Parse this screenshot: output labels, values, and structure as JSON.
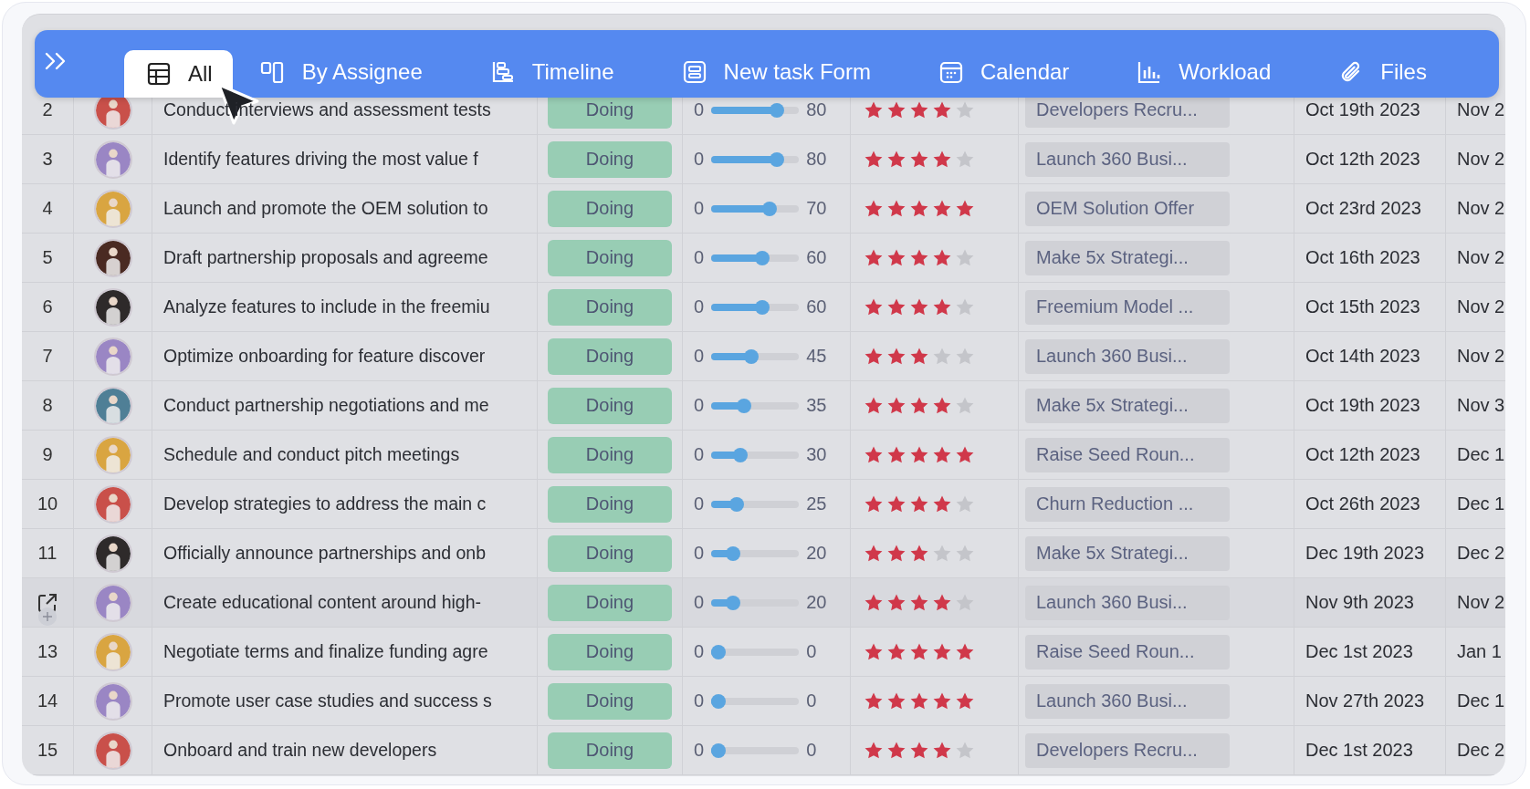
{
  "toolbar": {
    "tabs": [
      {
        "label": "All",
        "selected": true
      },
      {
        "label": "By Assignee",
        "selected": false
      },
      {
        "label": "Timeline",
        "selected": false
      },
      {
        "label": "New task Form",
        "selected": false
      },
      {
        "label": "Calendar",
        "selected": false
      },
      {
        "label": "Workload",
        "selected": false
      },
      {
        "label": "Files",
        "selected": false
      }
    ]
  },
  "table": {
    "rows": [
      {
        "number": "2",
        "hovered": false,
        "avatar": {
          "color": "#c9504a"
        },
        "title": "Conduct interviews and assessment tests",
        "status": "Doing",
        "progress": {
          "min": "0",
          "level": 0.8,
          "value": "80"
        },
        "stars": 4,
        "goal": "Developers Recru...",
        "start": "Oct 19th 2023",
        "end": "Nov 2"
      },
      {
        "number": "3",
        "hovered": false,
        "avatar": {
          "color": "#9a86c4"
        },
        "title": "Identify features driving the most value f",
        "status": "Doing",
        "progress": {
          "min": "0",
          "level": 0.8,
          "value": "80"
        },
        "stars": 4,
        "goal": "Launch 360 Busi...",
        "start": "Oct 12th 2023",
        "end": "Nov 2"
      },
      {
        "number": "4",
        "hovered": false,
        "avatar": {
          "color": "#d9a541"
        },
        "title": "Launch and promote the OEM solution to",
        "status": "Doing",
        "progress": {
          "min": "0",
          "level": 0.7,
          "value": "70"
        },
        "stars": 5,
        "goal": "OEM Solution Offer",
        "start": "Oct 23rd 2023",
        "end": "Nov 2"
      },
      {
        "number": "5",
        "hovered": false,
        "avatar": {
          "color": "#4a2a22"
        },
        "title": "Draft partnership proposals and agreeme",
        "status": "Doing",
        "progress": {
          "min": "0",
          "level": 0.6,
          "value": "60"
        },
        "stars": 4,
        "goal": "Make 5x Strategi...",
        "start": "Oct 16th 2023",
        "end": "Nov 2"
      },
      {
        "number": "6",
        "hovered": false,
        "avatar": {
          "color": "#2e2a2a"
        },
        "title": "Analyze features to include in the freemiu",
        "status": "Doing",
        "progress": {
          "min": "0",
          "level": 0.6,
          "value": "60"
        },
        "stars": 4,
        "goal": "Freemium Model ...",
        "start": "Oct 15th 2023",
        "end": "Nov 2"
      },
      {
        "number": "7",
        "hovered": false,
        "avatar": {
          "color": "#9a86c4"
        },
        "title": "Optimize onboarding for feature discover",
        "status": "Doing",
        "progress": {
          "min": "0",
          "level": 0.45,
          "value": "45"
        },
        "stars": 3,
        "goal": "Launch 360 Busi...",
        "start": "Oct 14th 2023",
        "end": "Nov 2"
      },
      {
        "number": "8",
        "hovered": false,
        "avatar": {
          "color": "#4f7f96"
        },
        "title": "Conduct partnership negotiations and me",
        "status": "Doing",
        "progress": {
          "min": "0",
          "level": 0.35,
          "value": "35"
        },
        "stars": 4,
        "goal": "Make 5x Strategi...",
        "start": "Oct 19th 2023",
        "end": "Nov 3"
      },
      {
        "number": "9",
        "hovered": false,
        "avatar": {
          "color": "#d9a541"
        },
        "title": "Schedule and conduct pitch meetings",
        "status": "Doing",
        "progress": {
          "min": "0",
          "level": 0.3,
          "value": "30"
        },
        "stars": 5,
        "goal": "Raise Seed Roun...",
        "start": "Oct 12th 2023",
        "end": "Dec 1"
      },
      {
        "number": "10",
        "hovered": false,
        "avatar": {
          "color": "#c9504a"
        },
        "title": "Develop strategies to address the main c",
        "status": "Doing",
        "progress": {
          "min": "0",
          "level": 0.25,
          "value": "25"
        },
        "stars": 4,
        "goal": "Churn Reduction ...",
        "start": "Oct 26th 2023",
        "end": "Dec 1"
      },
      {
        "number": "11",
        "hovered": false,
        "avatar": {
          "color": "#2e2a2a"
        },
        "title": "Officially announce partnerships and onb",
        "status": "Doing",
        "progress": {
          "min": "0",
          "level": 0.2,
          "value": "20"
        },
        "stars": 3,
        "goal": "Make 5x Strategi...",
        "start": "Dec 19th 2023",
        "end": "Dec 2"
      },
      {
        "hovered": true,
        "avatar": {
          "color": "#9a86c4"
        },
        "title": "Create educational content around high-",
        "status": "Doing",
        "progress": {
          "min": "0",
          "level": 0.2,
          "value": "20"
        },
        "stars": 4,
        "goal": "Launch 360 Busi...",
        "start": "Nov 9th 2023",
        "end": "Nov 2"
      },
      {
        "number": "13",
        "hovered": false,
        "avatar": {
          "color": "#d9a541"
        },
        "title": "Negotiate terms and finalize funding agre",
        "status": "Doing",
        "progress": {
          "min": "0",
          "level": 0,
          "value": "0"
        },
        "stars": 5,
        "goal": "Raise Seed Roun...",
        "start": "Dec 1st 2023",
        "end": "Jan 1"
      },
      {
        "number": "14",
        "hovered": false,
        "avatar": {
          "color": "#9a86c4"
        },
        "title": "Promote user case studies and success s",
        "status": "Doing",
        "progress": {
          "min": "0",
          "level": 0,
          "value": "0"
        },
        "stars": 5,
        "goal": "Launch 360 Busi...",
        "start": "Nov 27th 2023",
        "end": "Dec 1"
      },
      {
        "number": "15",
        "hovered": false,
        "avatar": {
          "color": "#c9504a"
        },
        "title": "Onboard and train new developers",
        "status": "Doing",
        "progress": {
          "min": "0",
          "level": 0,
          "value": "0"
        },
        "stars": 4,
        "goal": "Developers Recru...",
        "start": "Dec 1st 2023",
        "end": "Dec 2"
      }
    ]
  }
}
